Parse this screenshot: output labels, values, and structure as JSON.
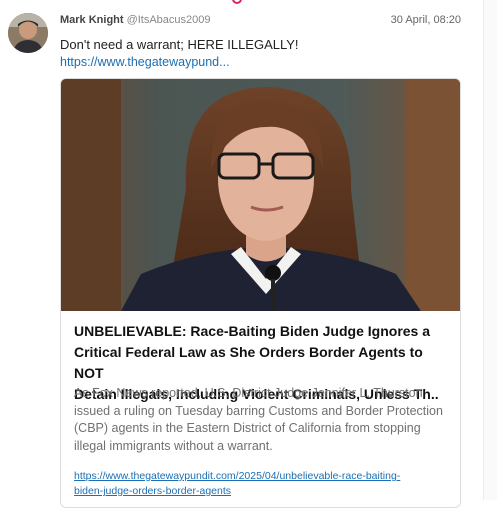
{
  "post": {
    "display_name": "Mark Knight",
    "handle": "@ItsAbacus2009",
    "timestamp": "30 April, 08:20",
    "text": "Don't need a warrant; HERE ILLEGALLY!",
    "link_text": "https://www.thegatewaypund..."
  },
  "link_card": {
    "title": "UNBELIEVABLE: Race-Baiting Biden Judge Ignores a\nCritical Federal Law as She Orders Border Agents to NOT\nDetain Illegals, Including Violent Criminals, Unless Th..",
    "description": "As Fox News reported, U.S. District Judge Jennifer L. Thurston issued a ruling on Tuesday barring Customs and Border Protection (CBP) agents in the Eastern District of California from stopping illegal immigrants without a warrant.",
    "url": "https://www.thegatewaypundit.com/2025/04/unbelievable-race-baiting-\nbiden-judge-orders-border-agents"
  },
  "colors": {
    "link": "#1a6fb5",
    "accent": "#e0245e"
  }
}
